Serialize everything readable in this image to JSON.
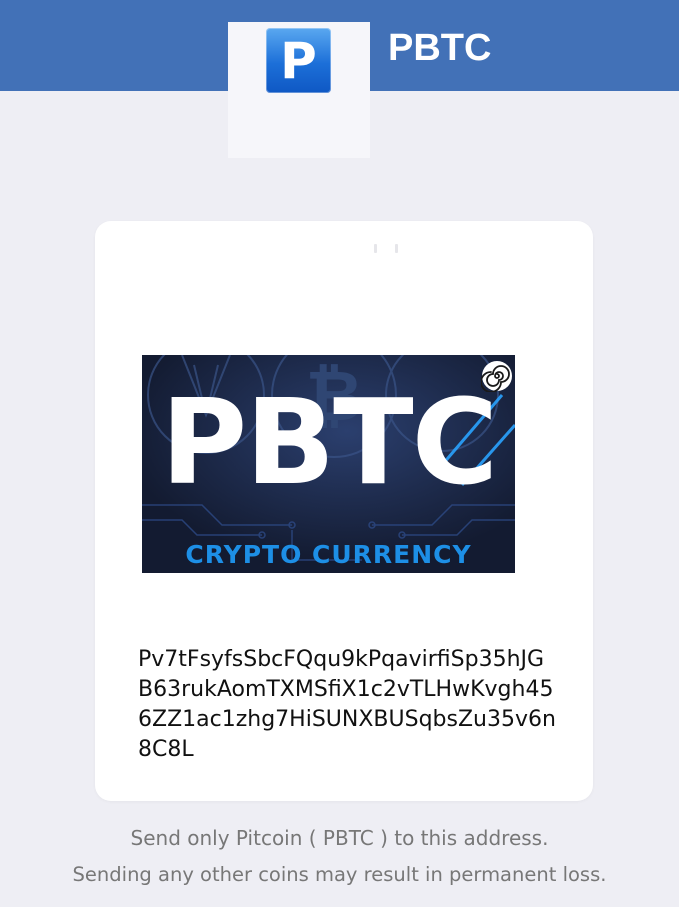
{
  "header": {
    "title": "PBTC",
    "logo_letter": "P",
    "logo_icon": "pitcoin-logo-icon"
  },
  "card": {
    "banner": {
      "title": "PBTC",
      "subtitle": "CRYPTO CURRENCY",
      "badge_icon": "swirl-icon"
    },
    "address": "Pv7tFsyfsSbcFQqu9kPqavirfiSp35hJGB63rukAomTXMSfiX1c2vTLHwKvgh456ZZ1ac1zhg7HiSUNXBUSqbsZu35v6n8C8L"
  },
  "notes": {
    "line1": "Send only Pitcoin ( PBTC ) to this address.",
    "line2": "Sending any other coins may result in permanent loss."
  },
  "colors": {
    "header_bg": "#4271b7",
    "page_bg": "#eeeef4",
    "banner_bg": "#16203a",
    "banner_accent": "#1d8fe6"
  }
}
